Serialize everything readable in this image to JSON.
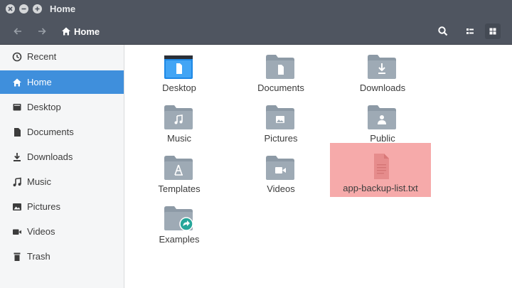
{
  "window": {
    "title": "Home",
    "controls": [
      "close",
      "minimize",
      "maximize"
    ]
  },
  "toolbar": {
    "back_icon": "arrow-left",
    "forward_icon": "arrow-right",
    "location": "Home",
    "location_icon": "home",
    "search_icon": "search",
    "list_view_icon": "list-view",
    "grid_view_icon": "grid-view",
    "active_view": "grid"
  },
  "sidebar": {
    "items": [
      {
        "label": "Recent",
        "icon": "clock"
      },
      {
        "label": "Home",
        "icon": "home",
        "active": true
      },
      {
        "label": "Desktop",
        "icon": "desktop"
      },
      {
        "label": "Documents",
        "icon": "document"
      },
      {
        "label": "Downloads",
        "icon": "download"
      },
      {
        "label": "Music",
        "icon": "music-note"
      },
      {
        "label": "Pictures",
        "icon": "picture"
      },
      {
        "label": "Videos",
        "icon": "video"
      },
      {
        "label": "Trash",
        "icon": "trash"
      }
    ]
  },
  "files": [
    {
      "name": "Desktop",
      "icon": "desktop-folder"
    },
    {
      "name": "Documents",
      "icon": "documents-folder"
    },
    {
      "name": "Downloads",
      "icon": "downloads-folder"
    },
    {
      "name": "Music",
      "icon": "music-folder"
    },
    {
      "name": "Pictures",
      "icon": "pictures-folder"
    },
    {
      "name": "Public",
      "icon": "public-folder"
    },
    {
      "name": "Templates",
      "icon": "templates-folder"
    },
    {
      "name": "Videos",
      "icon": "videos-folder"
    },
    {
      "name": "app-backup-list.txt",
      "icon": "text-file",
      "selected": true
    },
    {
      "name": "Examples",
      "icon": "examples-symlink-folder"
    }
  ],
  "colors": {
    "headerbar": "#4f5560",
    "sidebar_active": "#3f8fdc",
    "folder": "#8d9aa6",
    "selection": "#f6aaaa",
    "symlink_badge": "#26a69a"
  }
}
